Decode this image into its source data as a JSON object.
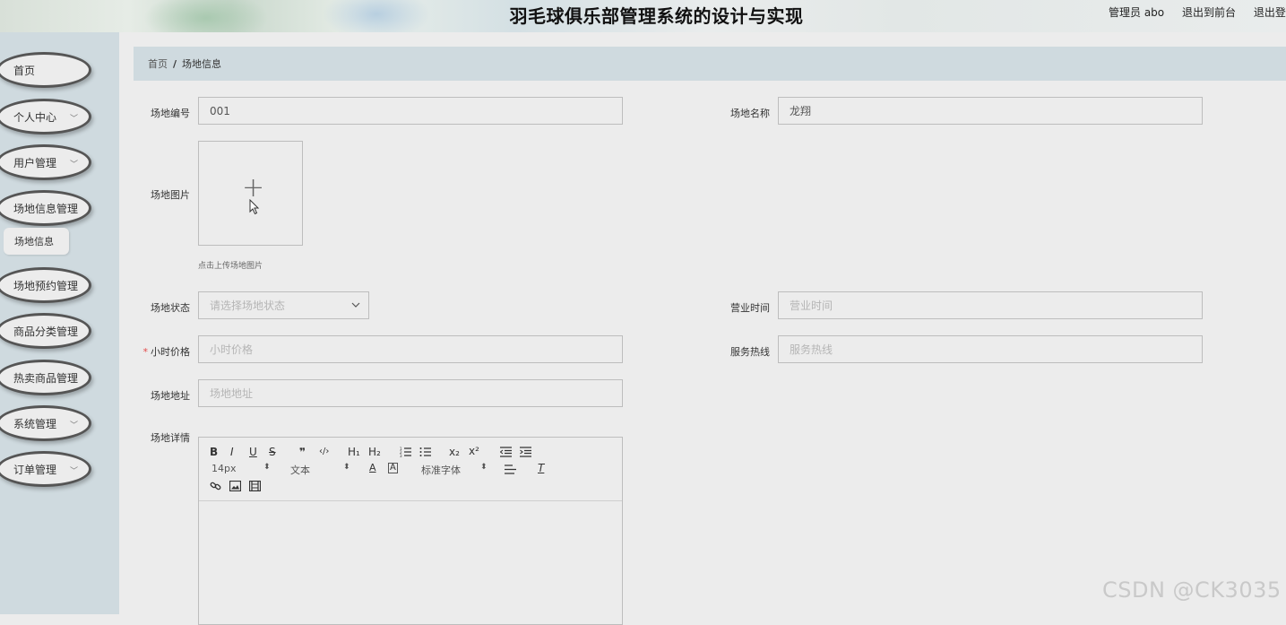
{
  "header": {
    "title": "羽毛球俱乐部管理系统的设计与实现",
    "user_text": "管理员 abo",
    "back_link": "退出到前台",
    "logout": "退出登"
  },
  "sidebar": {
    "items": [
      {
        "label": "首页",
        "has_chevron": false
      },
      {
        "label": "个人中心",
        "has_chevron": true
      },
      {
        "label": "用户管理",
        "has_chevron": true
      },
      {
        "label": "场地信息管理",
        "has_chevron": false
      },
      {
        "label": "场地预约管理",
        "has_chevron": false
      },
      {
        "label": "商品分类管理",
        "has_chevron": false
      },
      {
        "label": "热卖商品管理",
        "has_chevron": false
      },
      {
        "label": "系统管理",
        "has_chevron": true
      },
      {
        "label": "订单管理",
        "has_chevron": true
      }
    ],
    "active_sub": "场地信息"
  },
  "breadcrumb": {
    "home": "首页",
    "separator": "/",
    "current": "场地信息"
  },
  "form": {
    "venue_no_label": "场地编号",
    "venue_no_value": "001",
    "venue_name_label": "场地名称",
    "venue_name_value": "龙翔",
    "image_label": "场地图片",
    "image_tip": "点击上传场地图片",
    "status_label": "场地状态",
    "status_placeholder": "请选择场地状态",
    "hours_label": "营业时间",
    "hours_placeholder": "营业时间",
    "price_label": "小时价格",
    "price_placeholder": "小时价格",
    "price_required_mark": "*",
    "hotline_label": "服务热线",
    "hotline_placeholder": "服务热线",
    "address_label": "场地地址",
    "address_placeholder": "场地地址",
    "detail_label": "场地详情"
  },
  "editor": {
    "bold": "B",
    "italic": "I",
    "underline": "U",
    "strike": "S",
    "quote": "❞",
    "code": "‹/›",
    "h1": "H₁",
    "h2": "H₂",
    "size_value": "14px",
    "header_value": "文本",
    "font_value": "标准字体",
    "sub": "x₂",
    "sup": "x²"
  },
  "watermark": "CSDN @CK3035",
  "colors": {
    "sidebar_bg": "#cfdadf",
    "page_bg": "#ececec",
    "required": "#e34a4a"
  }
}
